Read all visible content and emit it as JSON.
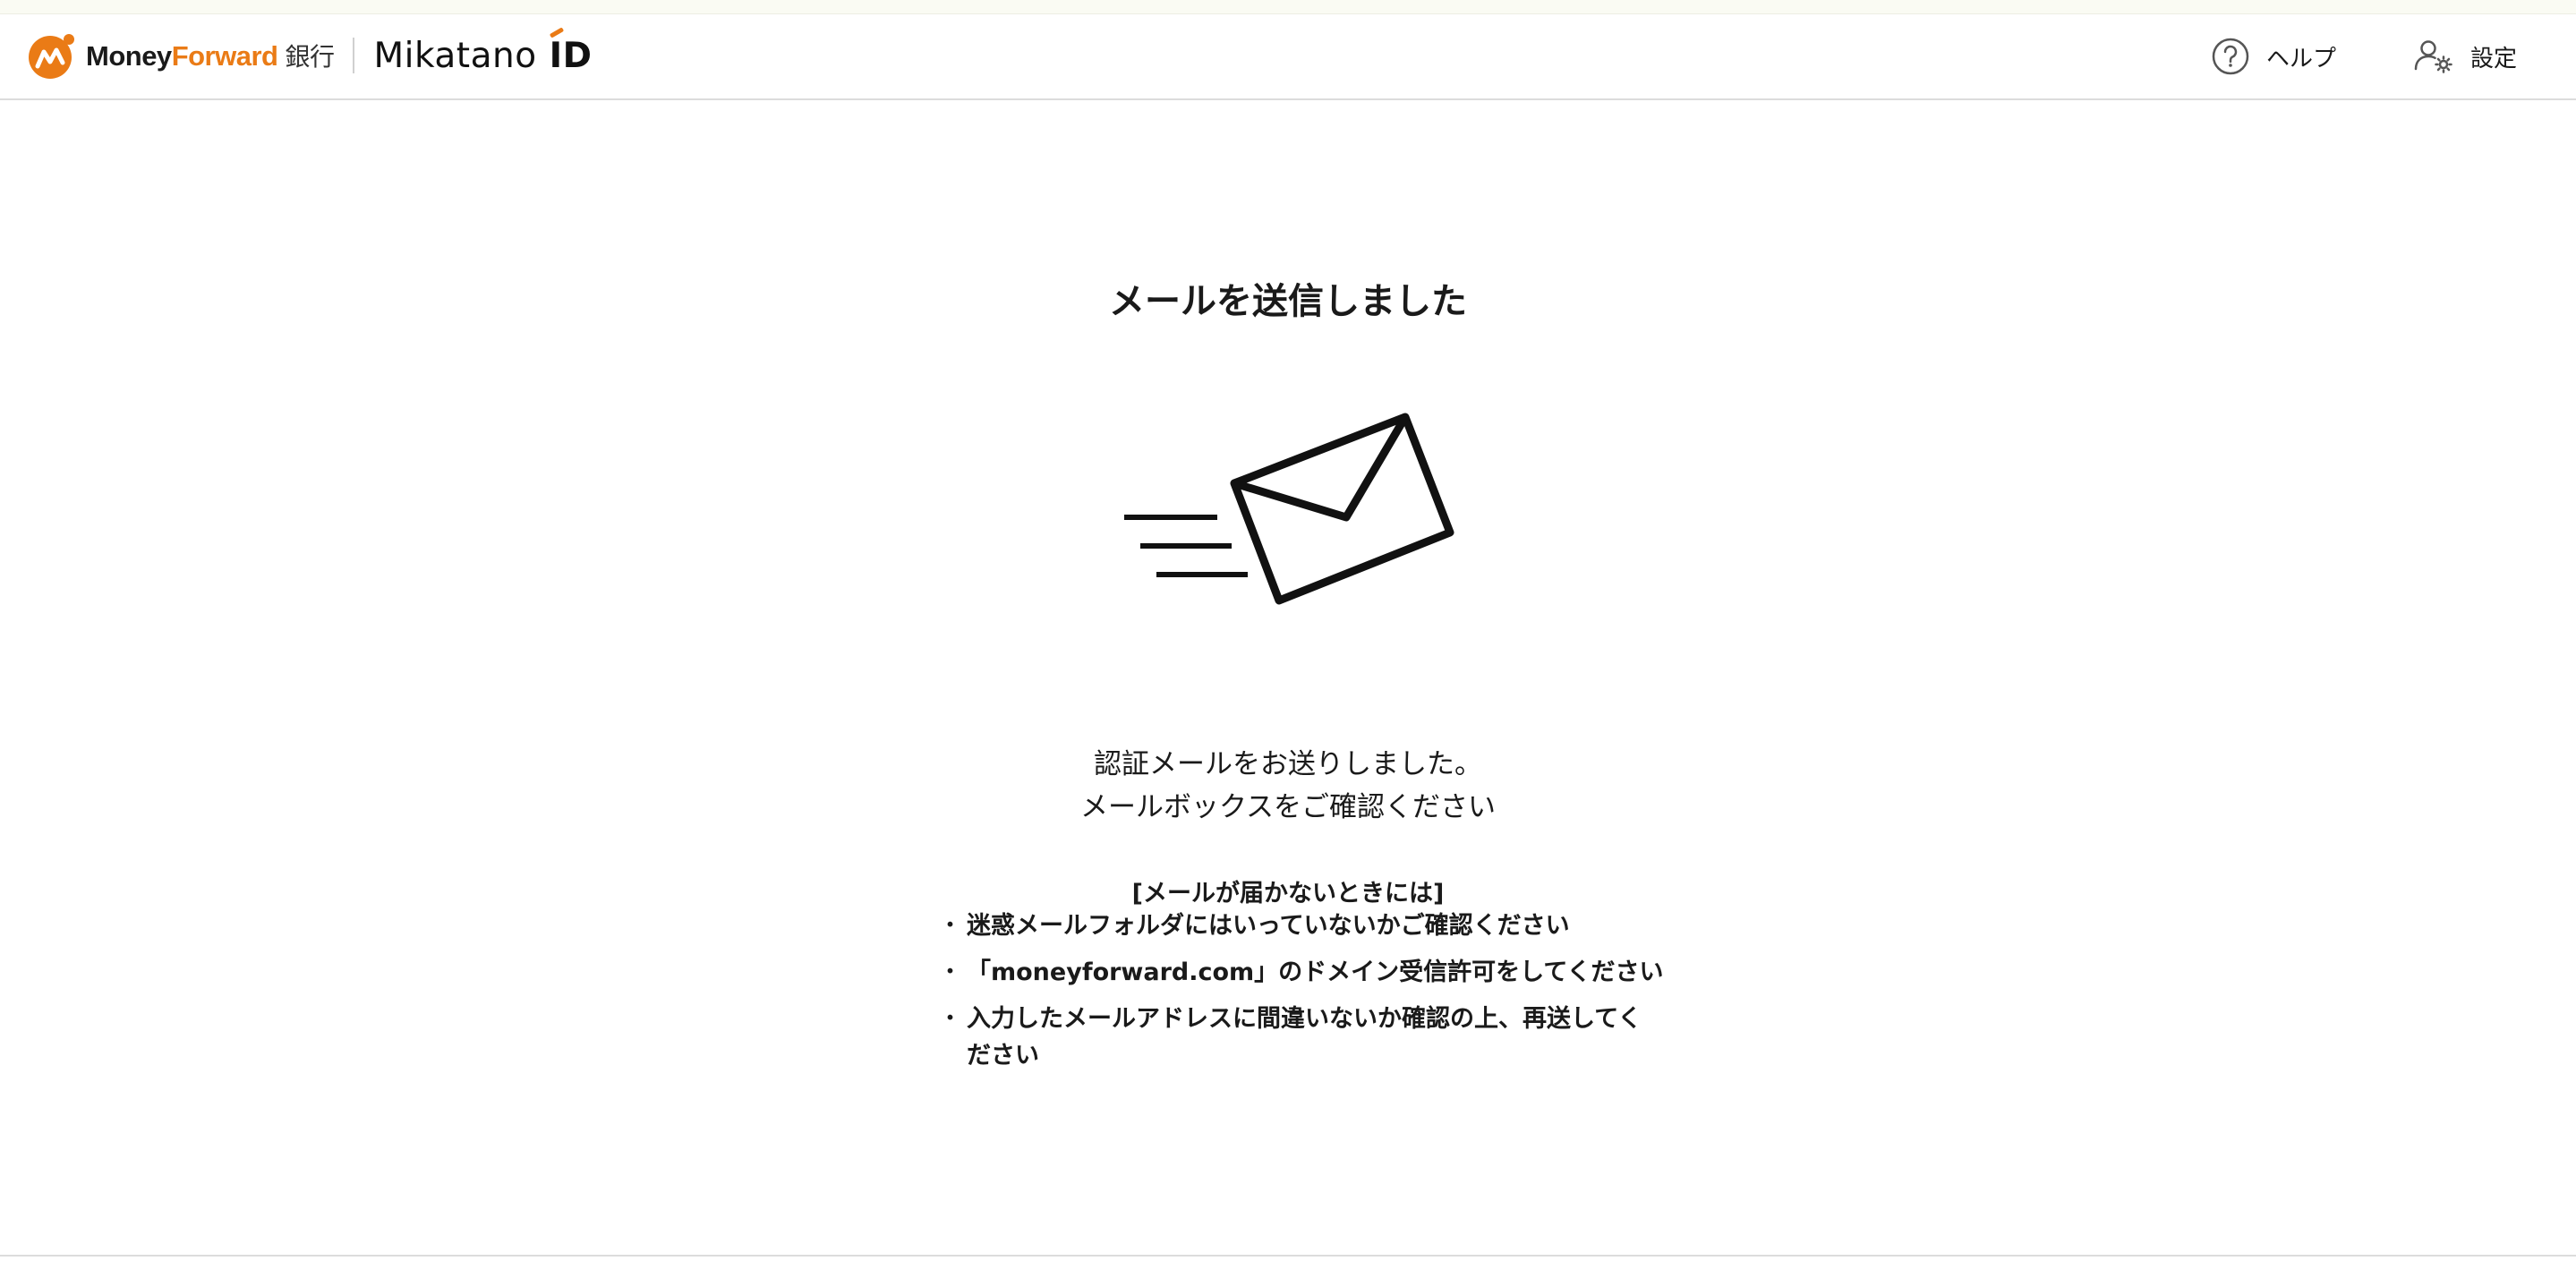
{
  "header": {
    "brand": {
      "logo_icon": "money-forward-logo-icon",
      "money": "Money",
      "forward": "Forward",
      "bank": "銀行",
      "product": "Mikatano",
      "product_suffix": "ID"
    },
    "help_label": "ヘルプ",
    "help_icon": "question-circle-icon",
    "settings_label": "設定",
    "settings_icon": "user-gear-icon"
  },
  "main": {
    "title": "メールを送信しました",
    "illustration_icon": "sending-envelope-icon",
    "message_lines": [
      "認証メールをお送りしました。",
      "メールボックスをご確認ください"
    ],
    "tips_title": "[メールが届かないときには]",
    "tips": [
      "迷惑メールフォルダにはいっていないかご確認ください",
      "「moneyforward.com」のドメイン受信許可をしてください",
      "入力したメールアドレスに間違いないか確認の上、再送してください"
    ]
  },
  "colors": {
    "brand_orange": "#ea7b16",
    "text": "#1a1a1a",
    "divider": "#dcdcdc"
  }
}
